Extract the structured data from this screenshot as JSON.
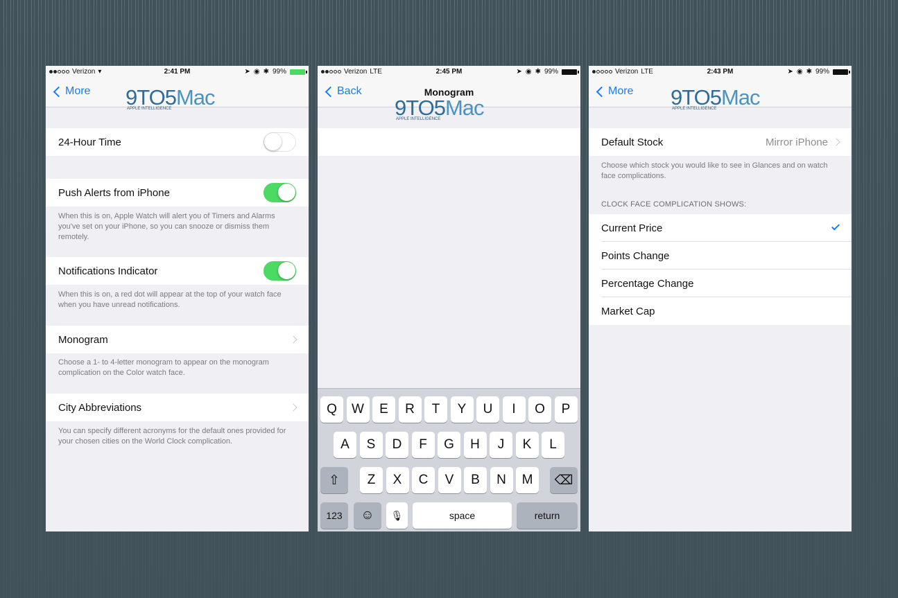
{
  "screens": [
    {
      "status": {
        "carrier": "Verizon",
        "network": "wifi",
        "time": "2:41 PM",
        "battery": "99%"
      },
      "nav": {
        "back": "More",
        "title": ""
      },
      "logo": {
        "main": "9TO5",
        "mac": "Mac",
        "sub": "APPLE INTELLIGENCE"
      },
      "rows": [
        {
          "label": "24-Hour Time",
          "toggle": false
        },
        {
          "label": "Push Alerts from iPhone",
          "toggle": true,
          "footer": "When this is on, Apple Watch will alert you of Timers and Alarms you've set on your iPhone, so you can snooze or dismiss them remotely."
        },
        {
          "label": "Notifications Indicator",
          "toggle": true,
          "footer": "When this is on, a red dot will appear at the top of your watch face when you have unread notifications."
        },
        {
          "label": "Monogram",
          "footer": "Choose a 1- to 4-letter monogram to appear on the monogram complication on the Color watch face."
        },
        {
          "label": "City Abbreviations",
          "footer": "You can specify different acronyms for the default ones provided for your chosen cities on the World Clock complication."
        }
      ]
    },
    {
      "status": {
        "carrier": "Verizon",
        "network": "LTE",
        "time": "2:45 PM",
        "battery": "99%"
      },
      "nav": {
        "back": "Back",
        "title": "Monogram"
      },
      "logo": {
        "main": "9TO5",
        "mac": "Mac",
        "sub": "APPLE INTELLIGENCE"
      },
      "input": {
        "value": "",
        "placeholder": ""
      },
      "keyboard": {
        "row1": [
          "Q",
          "W",
          "E",
          "R",
          "T",
          "Y",
          "U",
          "I",
          "O",
          "P"
        ],
        "row2": [
          "A",
          "S",
          "D",
          "F",
          "G",
          "H",
          "J",
          "K",
          "L"
        ],
        "row3": [
          "Z",
          "X",
          "C",
          "V",
          "B",
          "N",
          "M"
        ],
        "numbers": "123",
        "space": "space",
        "return": "return"
      }
    },
    {
      "status": {
        "carrier": "Verizon",
        "network": "LTE",
        "time": "2:43 PM",
        "battery": "99%"
      },
      "nav": {
        "back": "More",
        "title": ""
      },
      "logo": {
        "main": "9TO5",
        "mac": "Mac",
        "sub": "APPLE INTELLIGENCE"
      },
      "default_stock": {
        "label": "Default Stock",
        "value": "Mirror iPhone",
        "footer": "Choose which stock you would like to see in Glances and on watch face complications."
      },
      "section_header": "CLOCK FACE COMPLICATION SHOWS:",
      "options": [
        {
          "label": "Current Price",
          "selected": true
        },
        {
          "label": "Points Change",
          "selected": false
        },
        {
          "label": "Percentage Change",
          "selected": false
        },
        {
          "label": "Market Cap",
          "selected": false
        }
      ],
      "accent": "#1a7cf5"
    }
  ]
}
